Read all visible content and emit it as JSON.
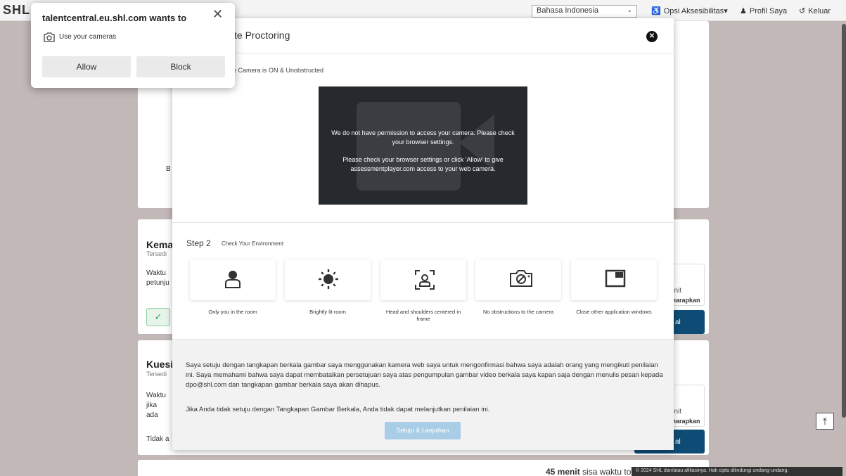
{
  "browser_prompt": {
    "title": "talentcentral.eu.shl.com wants to",
    "permission": "Use your cameras",
    "allow": "Allow",
    "block": "Block"
  },
  "topbar": {
    "brand": "SHL",
    "language": "Bahasa Indonesia",
    "accessibility": "Opsi Aksesibilitas",
    "profile": "Profil Saya",
    "logout": "Keluar"
  },
  "modal": {
    "title": "te Proctoring",
    "step1_text": "e Camera is ON & Unobstructed",
    "camera_msg_1": "We do not have permission to access your camera. Please check your browser settings.",
    "camera_msg_2": "Please check your browser settings or click 'Allow' to give assessmentplayer.com access to your web camera.",
    "step2_label": "Step 2",
    "step2_sub": "Check Your Environment",
    "env_items": [
      {
        "label": "Only you in the room",
        "icon": "person-icon"
      },
      {
        "label": "Brightly lit room",
        "icon": "sun-icon"
      },
      {
        "label": "Head and shoulders centered in frame",
        "icon": "frame-person-icon"
      },
      {
        "label": "No obstructions to the camera",
        "icon": "camera-blocked-icon"
      },
      {
        "label": "Close other application windows",
        "icon": "window-icon"
      }
    ],
    "consent_1": "Saya setuju dengan tangkapan berkala gambar saya menggunakan kamera web saya untuk mengonfirmasi bahwa saya adalah orang yang mengikuti penilaian ini. Saya memahami bahwa saya dapat membatalkan persetujuan saya atas pengumpulan gambar video berkala saya kapan saja dengan menulis pesan kepada dpo@shl.com dan tangkapan gambar berkala saya akan dihapus.",
    "consent_2": "Jika Anda tidak setuju dengan Tangkapan Gambar Berkala, Anda tidak dapat melanjutkan penilaian ini.",
    "agree_button": "Setuju & Lanjutkan"
  },
  "background": {
    "card1_letter": "B",
    "card2_title": "Kema",
    "card2_sub": "Tersedi",
    "card2_text": "Waktu petunju",
    "card2_side_1": "enit",
    "card2_side_2": "iharapkan",
    "card2_btn": "al",
    "card3_title": "Kuesi",
    "card3_sub": "Tersedi",
    "card3_text": "Waktu jika ada",
    "card3_foot": "Tidak a",
    "card3_side_1": "enit",
    "card3_side_2": "iharapkan",
    "card3_btn": "al",
    "time_value": "45 menit",
    "time_rest": "sisa waktu tota",
    "copyright": "© 2024 SHL dan/atau afiliasinya. Hak cipta dilindungi undang-undang."
  }
}
